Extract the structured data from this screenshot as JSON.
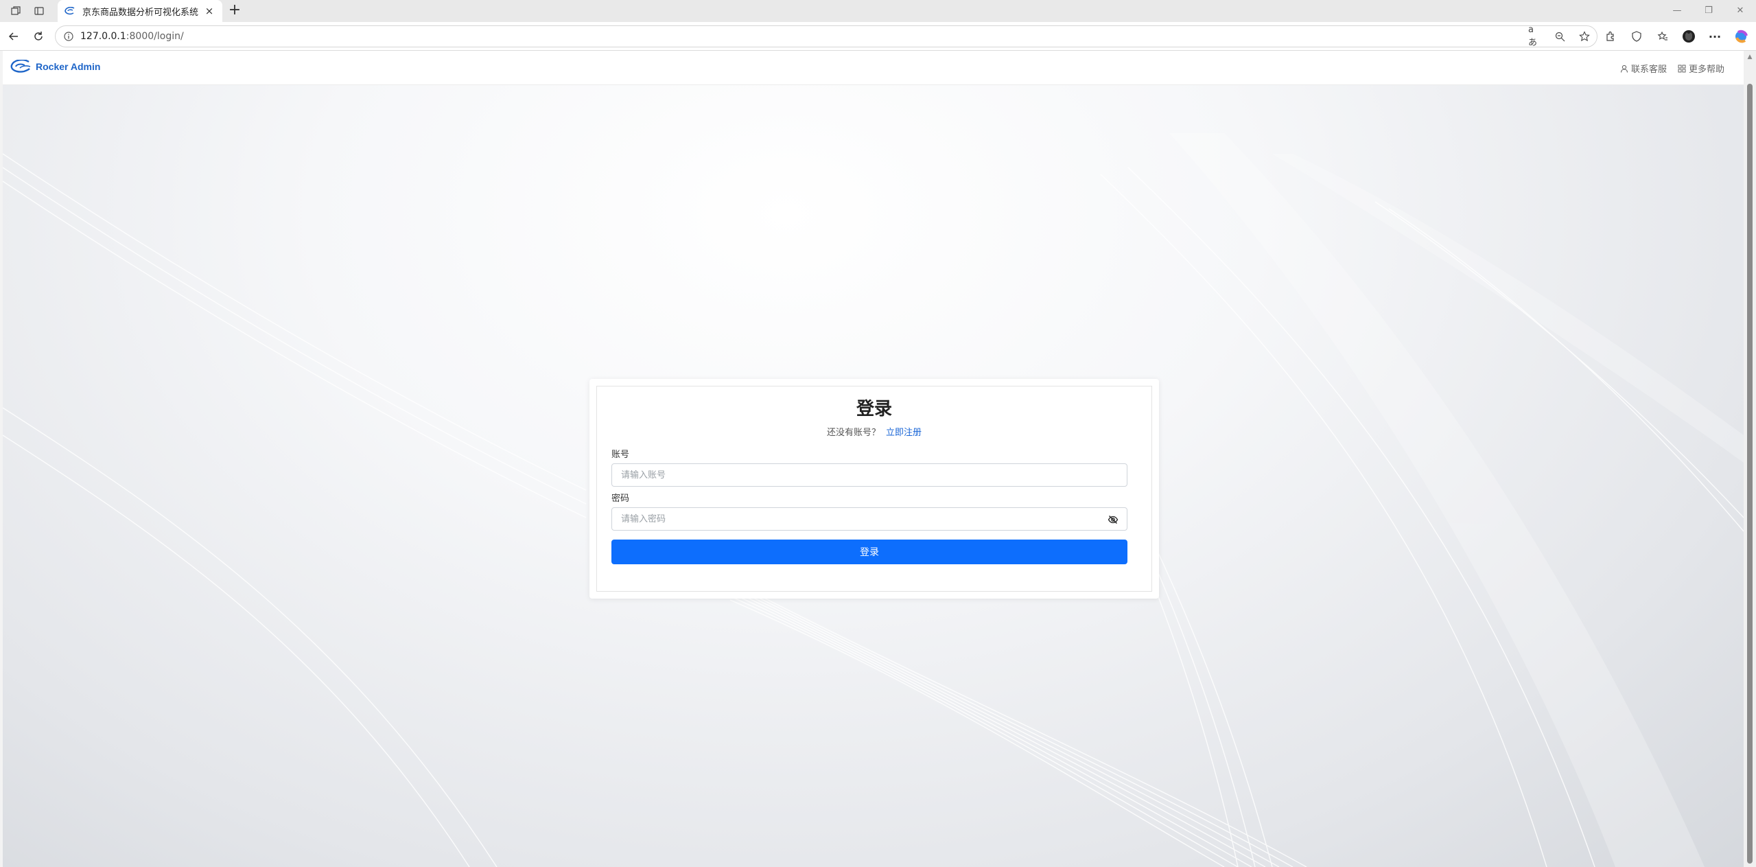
{
  "browser": {
    "tab_title": "京东商品数据分析可视化系统",
    "tab_close": "×",
    "new_tab": "+",
    "url_host": "127.0.0.1",
    "url_rest": ":8000/login/",
    "read_aloud": "aあ",
    "window_minimize": "—",
    "window_restore": "❐",
    "window_close": "✕"
  },
  "header": {
    "brand": "Rocker Admin",
    "links": [
      {
        "label": "联系客服",
        "icon": "user-icon"
      },
      {
        "label": "更多帮助",
        "icon": "grid-icon"
      }
    ]
  },
  "login": {
    "title": "登录",
    "no_account": "还没有账号？",
    "register_link": "立即注册",
    "account_label": "账号",
    "account_placeholder": "请输入账号",
    "account_value": "",
    "password_label": "密码",
    "password_placeholder": "请输入密码",
    "password_value": "",
    "submit": "登录"
  },
  "colors": {
    "accent": "#0d6efd",
    "brand": "#1e65c8",
    "link": "#1a66d6"
  }
}
